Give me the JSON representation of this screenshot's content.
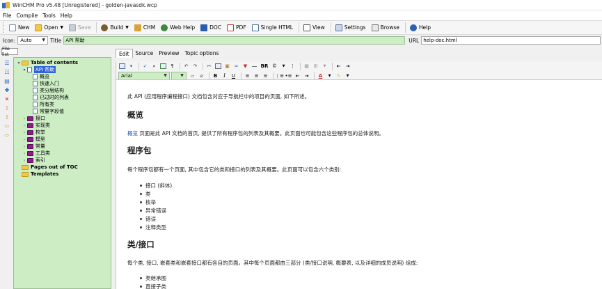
{
  "window": {
    "title": "WinCHM Pro v5.48 [Unregistered] - golden-javasdk.wcp"
  },
  "menu": [
    "File",
    "Compile",
    "Tools",
    "Help"
  ],
  "toolbar": {
    "new": "New",
    "open": "Open",
    "save": "Save",
    "build": "Build",
    "chm": "CHM",
    "webhelp": "Web Help",
    "doc": "DOC",
    "pdf": "PDF",
    "singlehtml": "Single HTML",
    "view": "View",
    "settings": "Settings",
    "browse": "Browse",
    "help": "Help"
  },
  "props": {
    "icon_label": "Icon:",
    "icon_value": "Auto",
    "title_label": "Title",
    "title_value": "API 帮助",
    "url_label": "URL",
    "url_value": "help-doc.html"
  },
  "filelist_tab": "File list",
  "tree": {
    "root": "Table of contents",
    "api_help": "API 帮助",
    "api_children": [
      "概览",
      "快速入门",
      "类分层结构",
      "已过时的列表",
      "所有类",
      "常量字段值"
    ],
    "books": [
      "接口",
      "实现类",
      "枚举",
      "模型",
      "常量",
      "工具类",
      "索引"
    ],
    "pages_out": "Pages out of TOC",
    "templates": "Templates"
  },
  "editor_tabs": [
    "Edit",
    "Source",
    "Preview",
    "Topic options"
  ],
  "format": {
    "font": "Arial",
    "size": "",
    "bold": "B",
    "italic": "I",
    "underline": "U",
    "br": "BR"
  },
  "document": {
    "intro": "此 API (应用程序编程接口) 文档包含对应于导航栏中的项目的页面, 如下所述。",
    "h_overview": "概览",
    "overview_link": "概览",
    "overview_text": " 页面是此 API 文档的首页, 提供了所有程序包的列表及其概要。此页面也可能包含这些程序包的总体说明。",
    "h_package": "程序包",
    "package_text": "每个程序包都有一个页面, 其中包含它的类和接口的列表及其概要。此页面可以包含六个类别:",
    "package_list": [
      "接口 (斜体)",
      "类",
      "枚举",
      "异常错误",
      "错误",
      "注释类型"
    ],
    "h_class": "类/接口",
    "class_text": "每个类, 接口, 嵌套类和嵌套接口都有各自的页面。其中每个页面都由三部分 (类/接口说明, 概要表, 以及详细的成员说明) 组成:",
    "class_list": [
      "类继承图",
      "直接子类"
    ]
  },
  "colors": {
    "tree_bg": "#cdeec5",
    "selection": "#2f63d8",
    "book": "#8b1e8c",
    "folder": "#f2c84b",
    "link": "#1f4fb0"
  }
}
